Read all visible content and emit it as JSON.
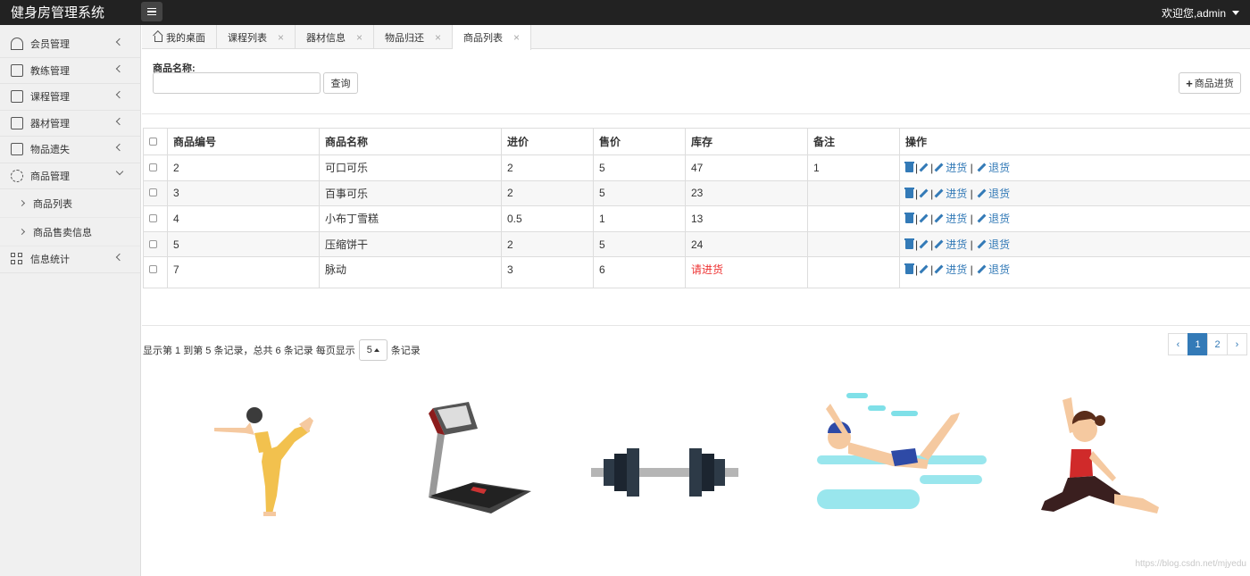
{
  "app": {
    "title": "健身房管理系统",
    "user_greeting": "欢迎您,admin"
  },
  "sidebar": {
    "items": [
      {
        "label": "会员管理",
        "icon": "user-icon"
      },
      {
        "label": "教练管理",
        "icon": "document-icon"
      },
      {
        "label": "课程管理",
        "icon": "document-icon"
      },
      {
        "label": "器材管理",
        "icon": "document-icon"
      },
      {
        "label": "物品遗失",
        "icon": "document-icon"
      },
      {
        "label": "商品管理",
        "icon": "gear-icon",
        "expanded": true,
        "children": [
          {
            "label": "商品列表"
          },
          {
            "label": "商品售卖信息"
          }
        ]
      },
      {
        "label": "信息统计",
        "icon": "grid-icon"
      }
    ]
  },
  "tabs": [
    {
      "label": "我的桌面",
      "closable": false,
      "active": false
    },
    {
      "label": "课程列表",
      "closable": true,
      "active": false
    },
    {
      "label": "器材信息",
      "closable": true,
      "active": false
    },
    {
      "label": "物品归还",
      "closable": true,
      "active": false
    },
    {
      "label": "商品列表",
      "closable": true,
      "active": true
    }
  ],
  "search": {
    "label": "商品名称:",
    "value": "",
    "button": "查询",
    "add_button": "商品进货"
  },
  "table": {
    "columns": [
      "商品编号",
      "商品名称",
      "进价",
      "售价",
      "库存",
      "备注",
      "操作"
    ],
    "rows": [
      [
        "2",
        "可口可乐",
        "2",
        "5",
        "47",
        "1"
      ],
      [
        "3",
        "百事可乐",
        "2",
        "5",
        "23",
        ""
      ],
      [
        "4",
        "小布丁雪糕",
        "0.5",
        "1",
        "13",
        ""
      ],
      [
        "5",
        "压缩饼干",
        "2",
        "5",
        "24",
        ""
      ],
      [
        "7",
        "脉动",
        "3",
        "6",
        "请进货",
        ""
      ]
    ],
    "ops": {
      "restock": "进货",
      "return": "退货"
    },
    "low_stock_color": "#e33333"
  },
  "pagination": {
    "info_prefix": "显示第 1 到第 5 条记录，总共 6 条记录 每页显示",
    "page_size": "5",
    "info_suffix": "条记录",
    "prev": "‹",
    "next": "›",
    "pages": [
      "1",
      "2"
    ],
    "current": "1"
  },
  "watermark": "https://blog.csdn.net/mjyedu",
  "colors": {
    "topbar": "#222222",
    "link": "#337ab7",
    "sidebar": "#f0f0f0"
  }
}
